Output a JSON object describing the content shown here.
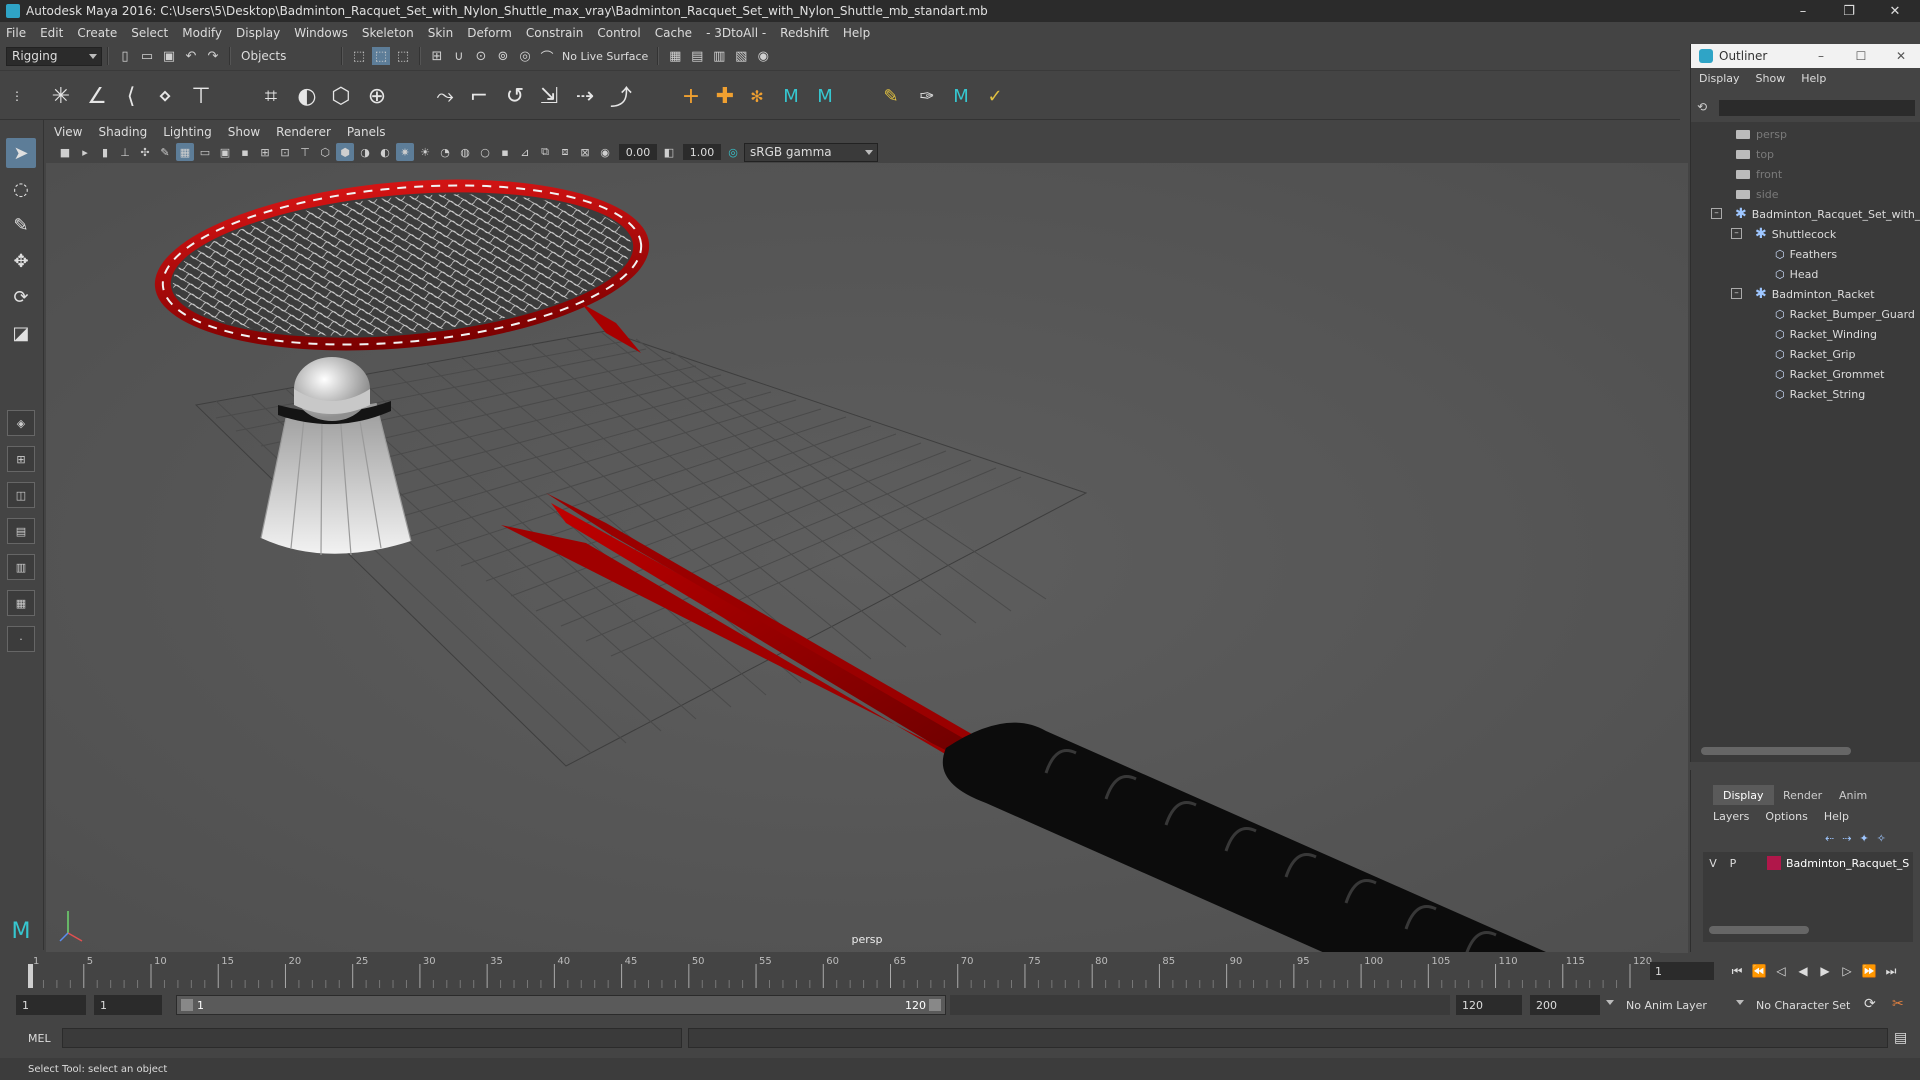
{
  "window": {
    "title": "Autodesk Maya 2016: C:\\Users\\5\\Desktop\\Badminton_Racquet_Set_with_Nylon_Shuttle_max_vray\\Badminton_Racquet_Set_with_Nylon_Shuttle_mb_standart.mb",
    "minimize": "–",
    "restore": "❐",
    "close": "✕"
  },
  "menubar": [
    "File",
    "Edit",
    "Create",
    "Select",
    "Modify",
    "Display",
    "Windows",
    "Skeleton",
    "Skin",
    "Deform",
    "Constrain",
    "Control",
    "Cache",
    "- 3DtoAll -",
    "Redshift",
    "Help"
  ],
  "statusline": {
    "mode": "Rigging",
    "selection_mode": "Objects",
    "live_surface": "No Live Surface"
  },
  "panel": {
    "menus": [
      "View",
      "Shading",
      "Lighting",
      "Show",
      "Renderer",
      "Panels"
    ],
    "exposure": "0.00",
    "gamma": "1.00",
    "color_space": "sRGB gamma",
    "camera_label": "persp"
  },
  "outliner": {
    "title": "Outliner",
    "menus": [
      "Display",
      "Show",
      "Help"
    ],
    "cameras": [
      "persp",
      "top",
      "front",
      "side"
    ],
    "root": "Badminton_Racquet_Set_with_",
    "groups": [
      {
        "name": "Shuttlecock",
        "children": [
          "Feathers",
          "Head"
        ]
      },
      {
        "name": "Badminton_Racket",
        "children": [
          "Racket_Bumper_Guard",
          "Racket_Winding",
          "Racket_Grip",
          "Racket_Grommet",
          "Racket_String"
        ]
      }
    ]
  },
  "layer_editor": {
    "tabs": [
      "Display",
      "Render",
      "Anim"
    ],
    "menus": [
      "Layers",
      "Options",
      "Help"
    ],
    "layer": {
      "v": "V",
      "p": "P",
      "name": "Badminton_Racquet_S",
      "color": "#b0174a"
    }
  },
  "timeline": {
    "ticks": [
      "1",
      "5",
      "10",
      "15",
      "20",
      "25",
      "30",
      "35",
      "40",
      "45",
      "50",
      "55",
      "60",
      "65",
      "70",
      "75",
      "80",
      "85",
      "90",
      "95",
      "100",
      "105",
      "110",
      "115",
      "120"
    ],
    "current_frame": "1"
  },
  "range": {
    "start": "1",
    "playback_start": "1",
    "slider_start": "1",
    "slider_end": "120",
    "playback_end": "120",
    "end": "200",
    "anim_layer": "No Anim Layer",
    "character_set": "No Character Set"
  },
  "command_line": {
    "lang": "MEL"
  },
  "help_line": "Select Tool: select an object"
}
